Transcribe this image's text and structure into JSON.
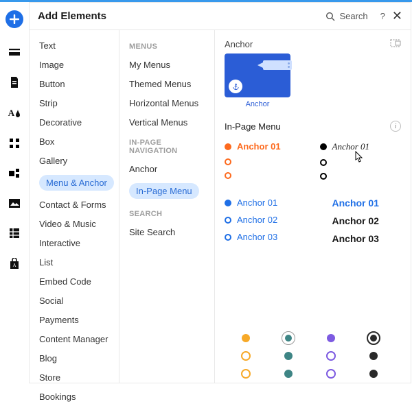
{
  "header": {
    "title": "Add Elements",
    "search": "Search",
    "help": "?",
    "close": "✕"
  },
  "categories": [
    "Text",
    "Image",
    "Button",
    "Strip",
    "Decorative",
    "Box",
    "Gallery",
    "Menu & Anchor",
    "Contact & Forms",
    "Video & Music",
    "Interactive",
    "List",
    "Embed Code",
    "Social",
    "Payments",
    "Content Manager",
    "Blog",
    "Store",
    "Bookings"
  ],
  "sub_sections": {
    "menus": {
      "heading": "MENUS",
      "items": [
        "My Menus",
        "Themed Menus",
        "Horizontal Menus",
        "Vertical Menus"
      ]
    },
    "inpage": {
      "heading": "IN-PAGE NAVIGATION",
      "items": [
        "Anchor",
        "In-Page Menu"
      ]
    },
    "search": {
      "heading": "SEARCH",
      "items": [
        "Site Search"
      ]
    }
  },
  "preview": {
    "anchor_section": "Anchor",
    "anchor_caption": "Anchor",
    "inpage_section": "In-Page Menu",
    "styles": {
      "labeled1": [
        "Anchor 01",
        "",
        ""
      ],
      "labeled2": [
        "Anchor 01",
        "",
        ""
      ],
      "labeled3": [
        "Anchor 01",
        "Anchor 02",
        "Anchor 03"
      ],
      "labeled4": [
        "Anchor 01",
        "Anchor 02",
        "Anchor 03"
      ]
    }
  }
}
